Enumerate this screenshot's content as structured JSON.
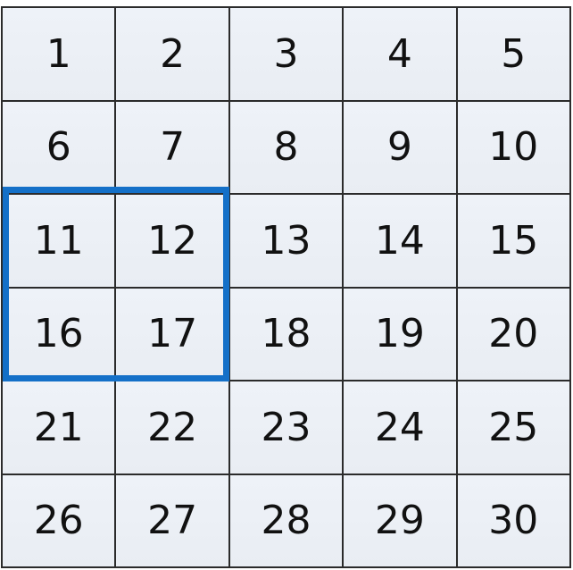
{
  "grid": {
    "columns": 5,
    "rows": 6,
    "cells": [
      "1",
      "2",
      "3",
      "4",
      "5",
      "6",
      "7",
      "8",
      "9",
      "10",
      "11",
      "12",
      "13",
      "14",
      "15",
      "16",
      "17",
      "18",
      "19",
      "20",
      "21",
      "22",
      "23",
      "24",
      "25",
      "26",
      "27",
      "28",
      "29",
      "30"
    ]
  },
  "selection": {
    "cells": [
      "11",
      "12",
      "16",
      "17"
    ],
    "color": "#1470c8"
  }
}
